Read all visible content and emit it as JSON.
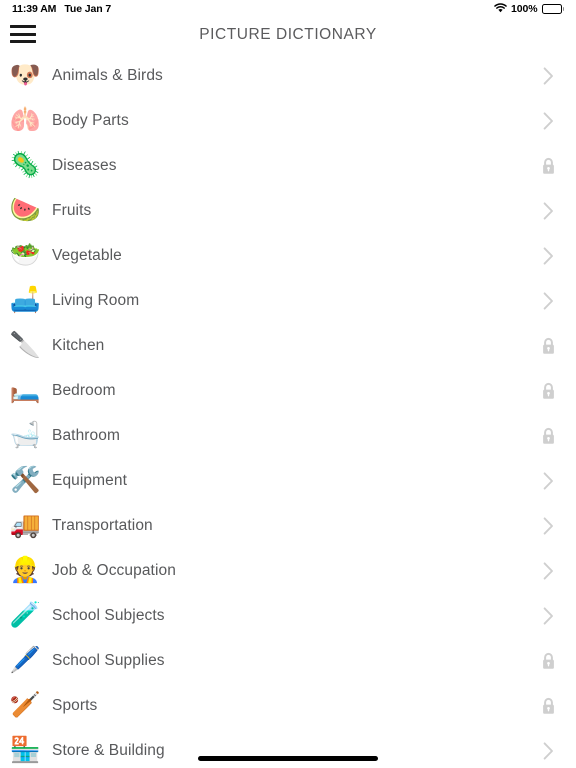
{
  "status_bar": {
    "time": "11:39 AM",
    "date": "Tue Jan 7",
    "wifi_icon": "wifi-icon",
    "battery_percent": "100%",
    "battery_icon": "battery-full-icon"
  },
  "nav_bar": {
    "menu_icon": "hamburger-menu-icon",
    "title": "PICTURE DICTIONARY"
  },
  "colors": {
    "background": "#ffffff",
    "label_text": "#58595b",
    "title_text": "#5b5b5d",
    "accessory": "#cfcfcf",
    "status_text": "#000000"
  },
  "list": {
    "items": [
      {
        "label": "Animals & Birds",
        "emoji": "🐶",
        "icon_name": "dog-face-icon",
        "accessory": "chevron"
      },
      {
        "label": "Body Parts",
        "emoji": "🫁",
        "icon_name": "stomach-icon",
        "accessory": "chevron"
      },
      {
        "label": "Diseases",
        "emoji": "🦠",
        "icon_name": "microbe-icon",
        "accessory": "lock"
      },
      {
        "label": "Fruits",
        "emoji": "🍉",
        "icon_name": "watermelon-icon",
        "accessory": "chevron"
      },
      {
        "label": "Vegetable",
        "emoji": "🥗",
        "icon_name": "green-salad-icon",
        "accessory": "chevron"
      },
      {
        "label": "Living Room",
        "emoji": "🛋️",
        "icon_name": "couch-icon",
        "accessory": "chevron"
      },
      {
        "label": "Kitchen",
        "emoji": "🔪",
        "icon_name": "kitchen-knives-icon",
        "accessory": "lock"
      },
      {
        "label": "Bedroom",
        "emoji": "🛏️",
        "icon_name": "bed-icon",
        "accessory": "lock"
      },
      {
        "label": "Bathroom",
        "emoji": "🛁",
        "icon_name": "bathtub-icon",
        "accessory": "lock"
      },
      {
        "label": "Equipment",
        "emoji": "🛠️",
        "icon_name": "tools-icon",
        "accessory": "chevron"
      },
      {
        "label": "Transportation",
        "emoji": "🚚",
        "icon_name": "delivery-truck-icon",
        "accessory": "chevron"
      },
      {
        "label": "Job & Occupation",
        "emoji": "👷",
        "icon_name": "construction-worker-icon",
        "accessory": "chevron"
      },
      {
        "label": "School Subjects",
        "emoji": "🧪",
        "icon_name": "test-tube-icon",
        "accessory": "chevron"
      },
      {
        "label": "School Supplies",
        "emoji": "🖊️",
        "icon_name": "pen-holder-icon",
        "accessory": "lock"
      },
      {
        "label": "Sports",
        "emoji": "🏏",
        "icon_name": "cricket-game-icon",
        "accessory": "lock"
      },
      {
        "label": "Store & Building",
        "emoji": "🏪",
        "icon_name": "convenience-store-icon",
        "accessory": "chevron"
      }
    ]
  },
  "home_indicator": {
    "name": "home-indicator"
  }
}
